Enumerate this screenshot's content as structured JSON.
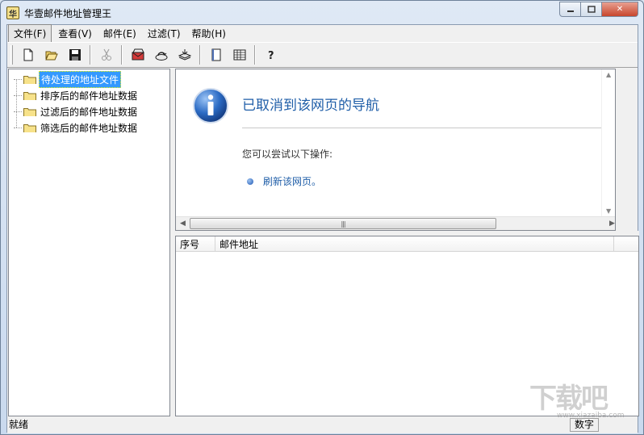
{
  "window": {
    "title": "华壹邮件地址管理王"
  },
  "menu": [
    {
      "label": "文件(F)"
    },
    {
      "label": "查看(V)"
    },
    {
      "label": "邮件(E)"
    },
    {
      "label": "过滤(T)"
    },
    {
      "label": "帮助(H)"
    }
  ],
  "toolbar": {
    "icons": [
      "new-file-icon",
      "open-folder-icon",
      "save-icon",
      "cut-icon",
      "mail-send-icon",
      "mail-receive-icon",
      "import-icon",
      "list-icon",
      "table-icon",
      "help-icon"
    ]
  },
  "tree": {
    "items": [
      {
        "label": "待处理的地址文件",
        "selected": true
      },
      {
        "label": "排序后的邮件地址数据"
      },
      {
        "label": "过滤后的邮件地址数据"
      },
      {
        "label": "筛选后的邮件地址数据"
      }
    ]
  },
  "browser": {
    "title": "已取消到该网页的导航",
    "hint": "您可以尝试以下操作:",
    "refresh_link": "刷新该网页。"
  },
  "list": {
    "columns": [
      "序号",
      "邮件地址"
    ]
  },
  "status": {
    "text": "就绪",
    "mode": "数字"
  },
  "watermark": {
    "text": "下载吧",
    "url": "www.xiazaiba.com"
  },
  "colors": {
    "selection": "#3399ff",
    "link": "#1f5ea8"
  }
}
